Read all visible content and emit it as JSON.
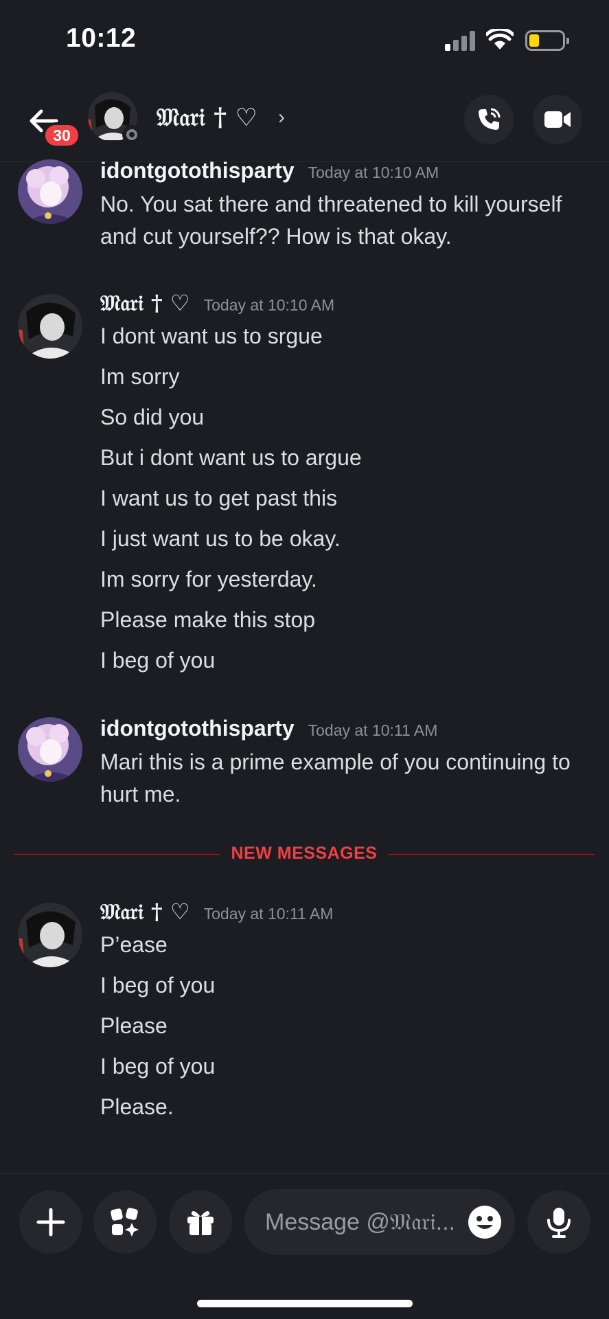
{
  "status_bar": {
    "time": "10:12",
    "battery_color": "#ffd60a"
  },
  "header": {
    "unread_count": "30",
    "contact_name": "𝔐𝔞𝔯𝔦 † ♡",
    "chevron": "›",
    "icons": {
      "back": "back-arrow-icon",
      "call": "phone-call-icon",
      "video": "video-camera-icon"
    }
  },
  "messages": [
    {
      "author": "idontgotothisparty",
      "timestamp": "Today at 10:10 AM",
      "lines": [
        "No. You sat there and threatened to kill yourself and cut yourself?? How is that okay."
      ]
    },
    {
      "author": "𝔐𝔞𝔯𝔦 † ♡",
      "timestamp": "Today at 10:10 AM",
      "lines": [
        "I dont want us to srgue",
        "Im sorry",
        "So did you",
        "But i dont want us to argue",
        "I want us to get past this",
        "I just want us to be okay.",
        "Im sorry for yesterday.",
        "Please make this stop",
        "I beg of you"
      ]
    },
    {
      "author": "idontgotothisparty",
      "timestamp": "Today at 10:11 AM",
      "lines": [
        "Mari this is a prime example of you continuing to hurt me."
      ]
    },
    {
      "author": "𝔐𝔞𝔯𝔦 † ♡",
      "timestamp": "Today at 10:11 AM",
      "lines": [
        "P’ease",
        "I beg of you",
        "Please",
        "I beg of you",
        "Please."
      ]
    }
  ],
  "divider": {
    "label": "NEW MESSAGES",
    "color": "#f23f43"
  },
  "composer": {
    "placeholder": "Message @𝔐𝔞𝔯𝔦...",
    "icons": {
      "attach": "plus-icon",
      "apps": "apps-sparkle-icon",
      "gift": "gift-icon",
      "emoji": "emoji-icon",
      "voice": "microphone-icon"
    }
  },
  "colors": {
    "background": "#1c1d22",
    "button": "#26272d",
    "accent_red": "#f23f43"
  }
}
